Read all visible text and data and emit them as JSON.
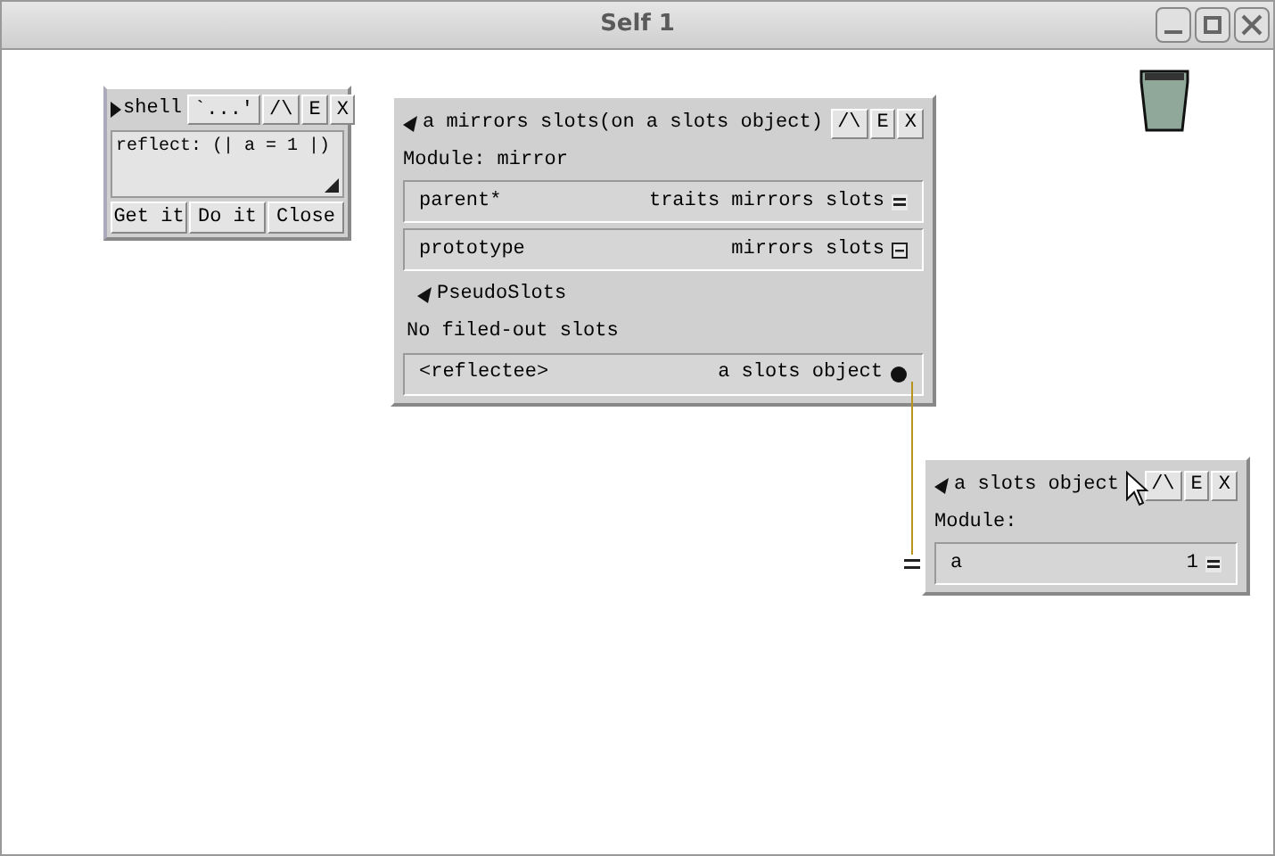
{
  "window": {
    "title": "Self 1"
  },
  "shell": {
    "title": "shell",
    "buttons": [
      "`...'",
      "/\\",
      "E",
      "X"
    ],
    "code": "reflect: (| a = 1 |)",
    "actions": [
      "Get it",
      "Do it",
      "Close"
    ]
  },
  "mirror": {
    "title": "a mirrors slots(on a slots object)",
    "buttons": [
      "/\\",
      "E",
      "X"
    ],
    "module": "Module: mirror",
    "slots": [
      {
        "name": "parent*",
        "value": "traits mirrors slots",
        "kind": "equals"
      },
      {
        "name": "prototype",
        "value": "mirrors slots",
        "kind": "box"
      }
    ],
    "pseudo": {
      "title": "PseudoSlots",
      "note": "No filed-out slots",
      "slots": [
        {
          "name": "<reflectee>",
          "value": "a slots object",
          "kind": "dot"
        }
      ]
    }
  },
  "object": {
    "title": "a slots object",
    "buttons": [
      "/\\",
      "E",
      "X"
    ],
    "module": "Module:",
    "slots": [
      {
        "name": "a",
        "value": "1",
        "kind": "equals"
      }
    ]
  }
}
